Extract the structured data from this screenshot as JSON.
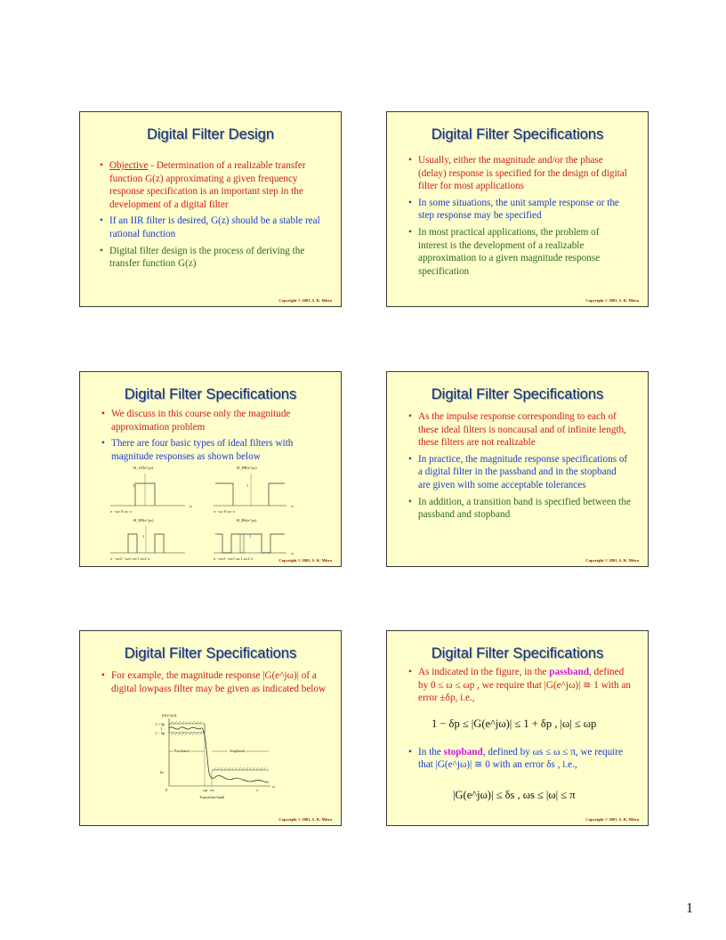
{
  "page_number": "1",
  "copyright": "Copyright © 2001, S. K. Mitra",
  "slides": [
    {
      "title": "Digital Filter Design",
      "bullets": [
        {
          "prefix": "Objective",
          "text": " - Determination of a realizable transfer function G(z) approximating a given frequency response specification is an important step in the development of a digital filter"
        },
        {
          "text": "If an IIR filter is desired, G(z) should be a stable real rational function"
        },
        {
          "text": "Digital filter design is the process of deriving the transfer function G(z)"
        }
      ]
    },
    {
      "title": "Digital Filter Specifications",
      "bullets": [
        {
          "text": "Usually, either the magnitude and/or the phase (delay) response is specified for the design of digital filter for most applications"
        },
        {
          "text": "In some situations, the unit sample response or the step response may be specified"
        },
        {
          "text": "In most practical applications, the problem of interest is the development of a realizable approximation to a given magnitude response specification"
        }
      ]
    },
    {
      "title": "Digital Filter Specifications",
      "bullets": [
        {
          "text": "We discuss in this course only the magnitude approximation problem"
        },
        {
          "text": "There are four basic types of ideal filters with magnitude responses as shown below"
        }
      ],
      "figure_labels": {
        "lp": "H_LP(e^jω)",
        "hp": "H_HP(e^jω)",
        "bp": "H_BP(e^jω)",
        "bs": "H_BS(e^jω)",
        "one": "1",
        "zero": "0",
        "omega": "ω",
        "lp_ticks": "π  −ωc  0  ωc  π",
        "hp_ticks": "π  −ωc  0  ωc  π",
        "bp_ticks": "π  −ωc2 −ωc1    ωc1 ωc2  π",
        "bs_ticks": "π  −ωc2 −ωc1    ωc1 ωc2  π"
      }
    },
    {
      "title": "Digital Filter Specifications",
      "bullets": [
        {
          "text": "As the impulse response corresponding to each of these ideal filters is noncausal and of infinite length, these filters are not realizable"
        },
        {
          "text": "In practice, the magnitude response specifications of a digital filter in the passband and in the stopband are given with some acceptable tolerances"
        },
        {
          "text": "In addition, a transition band is specified between the passband and stopband"
        }
      ]
    },
    {
      "title": "Digital Filter Specifications",
      "bullets": [
        {
          "text": "For example, the magnitude response |G(e^jω)| of a digital lowpass filter may be given as indicated below"
        }
      ],
      "figure_labels": {
        "yaxis": "|G(e^jω)|",
        "one_plus": "1 + δp",
        "one": "1",
        "one_minus": "1 − δp",
        "ds": "δs",
        "passband": "Passband",
        "stopband": "Stopband",
        "wp": "ωp",
        "ws": "ωs",
        "pi": "π",
        "omega": "ω",
        "transition": "Transition band",
        "zero": "0"
      }
    },
    {
      "title": "Digital Filter Specifications",
      "bullets": [
        {
          "pre": "As indicated in the figure, in the ",
          "emph": "passband",
          "post": ", defined by 0 ≤ ω ≤ ωp , we require that |G(e^jω)| ≅ 1 with an error ±δp, i.e.,"
        },
        {
          "pre": "In the ",
          "emph": "stopband",
          "post": ", defined by ωs ≤ ω ≤ π, we require that |G(e^jω)| ≅ 0 with an error δs , i.e.,"
        }
      ],
      "formula1": "1 − δp ≤ |G(e^jω)| ≤ 1 + δp ,   |ω| ≤ ωp",
      "formula2": "|G(e^jω)| ≤ δs ,   ωs ≤ |ω| ≤ π"
    }
  ]
}
